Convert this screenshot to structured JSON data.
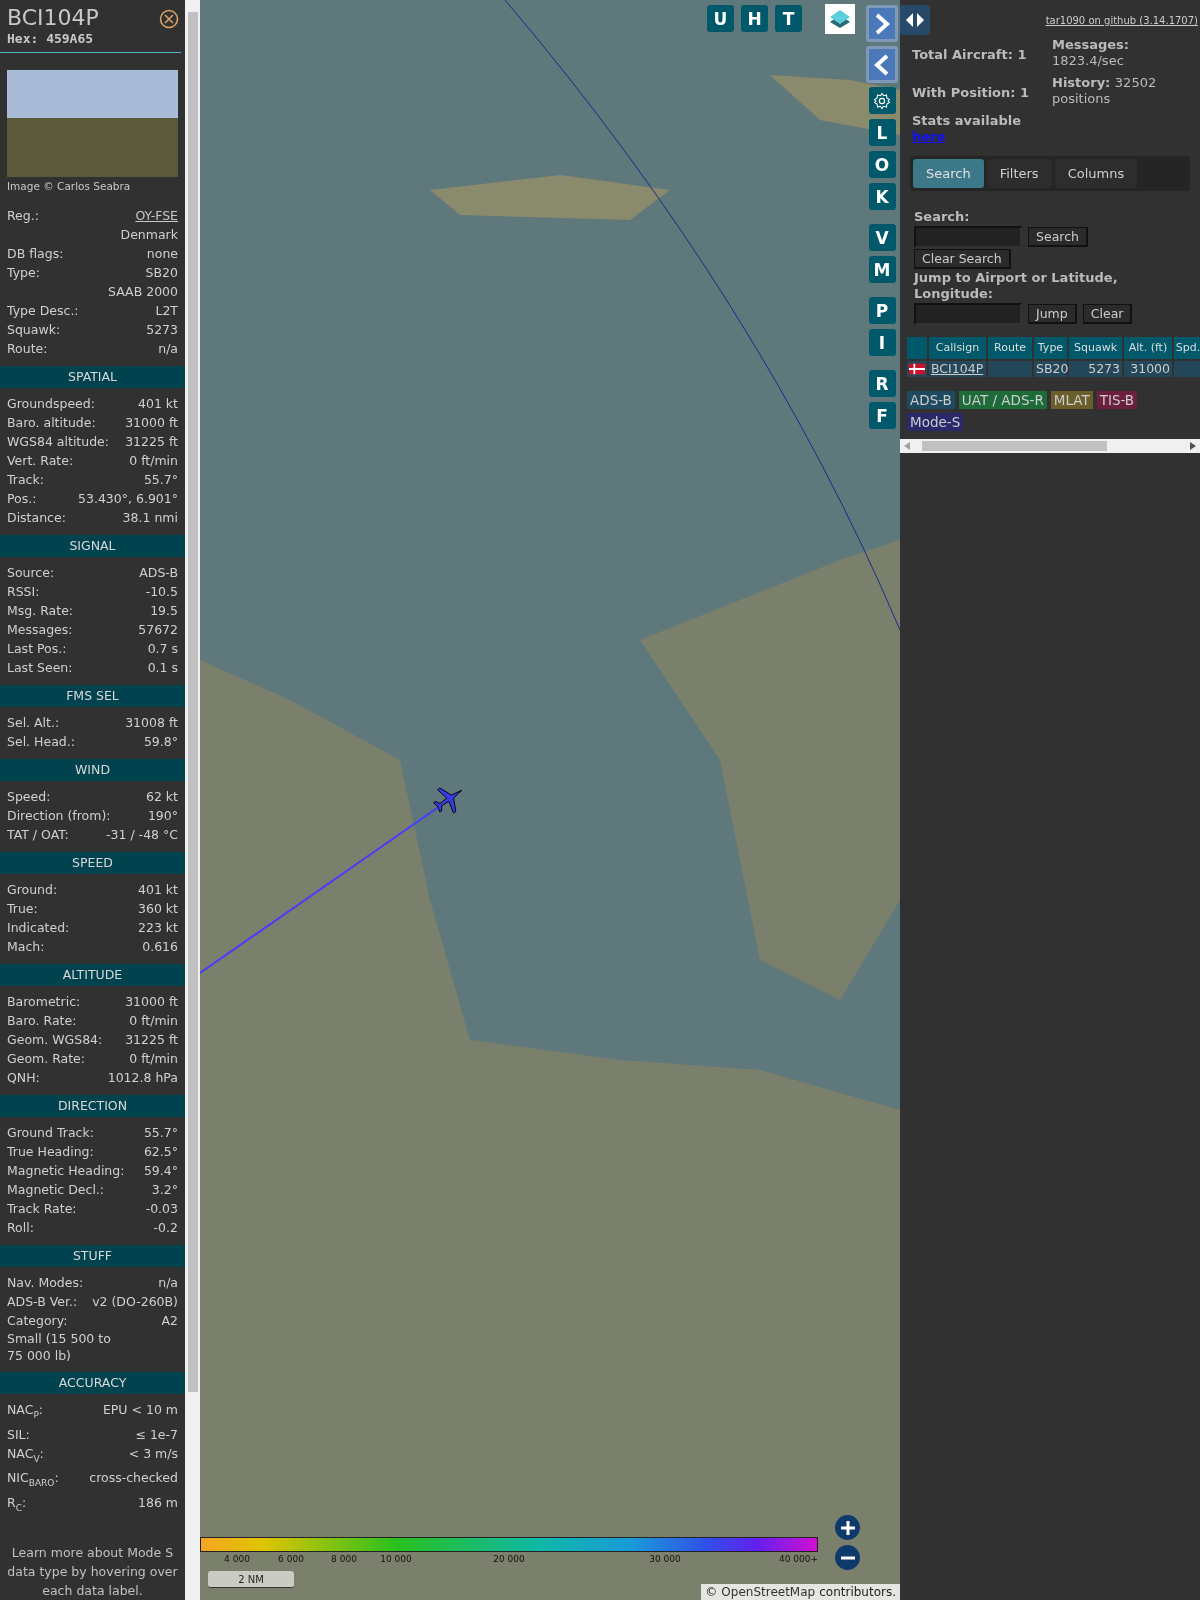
{
  "detail": {
    "callsign": "BCI104P",
    "hex_label": "Hex:",
    "hex": "459A65",
    "photo_credit": "Image © Carlos Seabra",
    "info_rows": [
      {
        "kind": "link",
        "label": "Reg.:",
        "value": "OY-FSE"
      },
      {
        "kind": "plain",
        "value": "Denmark"
      },
      {
        "kind": "plain",
        "label": "DB flags:",
        "value": "none"
      },
      {
        "kind": "plain",
        "label": "Type:",
        "value": "SB20"
      },
      {
        "kind": "plain",
        "value": "SAAB 2000"
      },
      {
        "kind": "plain",
        "label": "Type Desc.:",
        "value": "L2T"
      },
      {
        "kind": "plain",
        "label": "Squawk:",
        "value": "5273"
      },
      {
        "kind": "plain",
        "label": "Route:",
        "value": "n/a"
      }
    ],
    "sections": [
      {
        "title": "SPATIAL",
        "rows": [
          {
            "kind": "plain",
            "label": "Groundspeed:",
            "value": "401 kt"
          },
          {
            "kind": "plain",
            "label": "Baro. altitude:",
            "value": "31000 ft"
          },
          {
            "kind": "plain",
            "label": "WGS84 altitude:",
            "value": "31225 ft"
          },
          {
            "kind": "plain",
            "label": "Vert. Rate:",
            "value": "0 ft/min"
          },
          {
            "kind": "plain",
            "label": "Track:",
            "value": "55.7°"
          },
          {
            "kind": "plain",
            "label": "Pos.:",
            "value": "53.430°, 6.901°"
          },
          {
            "kind": "plain",
            "label": "Distance:",
            "value": "38.1 nmi"
          }
        ]
      },
      {
        "title": "SIGNAL",
        "rows": [
          {
            "kind": "plain",
            "label": "Source:",
            "value": "ADS-B"
          },
          {
            "kind": "plain",
            "label": "RSSI:",
            "value": "-10.5"
          },
          {
            "kind": "plain",
            "label": "Msg. Rate:",
            "value": "19.5"
          },
          {
            "kind": "plain",
            "label": "Messages:",
            "value": "57672"
          },
          {
            "kind": "plain",
            "label": "Last Pos.:",
            "value": "0.7 s"
          },
          {
            "kind": "plain",
            "label": "Last Seen:",
            "value": "0.1 s"
          }
        ]
      },
      {
        "title": "FMS SEL",
        "rows": [
          {
            "kind": "plain",
            "label": "Sel. Alt.:",
            "value": "31008 ft"
          },
          {
            "kind": "plain",
            "label": "Sel. Head.:",
            "value": "59.8°"
          }
        ]
      },
      {
        "title": "WIND",
        "rows": [
          {
            "kind": "plain",
            "label": "Speed:",
            "value": "62 kt"
          },
          {
            "kind": "plain",
            "label": "Direction (from):",
            "value": "190°"
          },
          {
            "kind": "plain",
            "label": "TAT / OAT:",
            "value": "-31 / -48 °C"
          }
        ]
      },
      {
        "title": "SPEED",
        "rows": [
          {
            "kind": "plain",
            "label": "Ground:",
            "value": "401 kt"
          },
          {
            "kind": "plain",
            "label": "True:",
            "value": "360 kt"
          },
          {
            "kind": "plain",
            "label": "Indicated:",
            "value": "223 kt"
          },
          {
            "kind": "plain",
            "label": "Mach:",
            "value": "0.616"
          }
        ]
      },
      {
        "title": "ALTITUDE",
        "rows": [
          {
            "kind": "plain",
            "label": "Barometric:",
            "value": "31000 ft"
          },
          {
            "kind": "plain",
            "label": "Baro. Rate:",
            "value": "0 ft/min"
          },
          {
            "kind": "plain",
            "label": "Geom. WGS84:",
            "value": "31225 ft"
          },
          {
            "kind": "plain",
            "label": "Geom. Rate:",
            "value": "0 ft/min"
          },
          {
            "kind": "plain",
            "label": "QNH:",
            "value": "1012.8 hPa"
          }
        ]
      },
      {
        "title": "DIRECTION",
        "rows": [
          {
            "kind": "plain",
            "label": "Ground Track:",
            "value": "55.7°"
          },
          {
            "kind": "plain",
            "label": "True Heading:",
            "value": "62.5°"
          },
          {
            "kind": "plain",
            "label": "Magnetic Heading:",
            "value": "59.4°"
          },
          {
            "kind": "plain",
            "label": "Magnetic Decl.:",
            "value": "3.2°"
          },
          {
            "kind": "plain",
            "label": "Track Rate:",
            "value": "-0.03"
          },
          {
            "kind": "plain",
            "label": "Roll:",
            "value": "-0.2"
          }
        ]
      },
      {
        "title": "STUFF",
        "rows": [
          {
            "kind": "plain",
            "label": "Nav. Modes:",
            "value": "n/a"
          },
          {
            "kind": "plain",
            "label": "ADS-B Ver.:",
            "value": "v2 (DO-260B)"
          },
          {
            "kind": "plain",
            "label": "Category:",
            "value": "A2"
          },
          {
            "kind": "wide",
            "value": "Small (15 500 to 75 000 lb)"
          }
        ]
      },
      {
        "title": "ACCURACY",
        "rows": [
          {
            "kind": "plain",
            "label": "NAC$_{P}$:",
            "value": "EPU < 10 m"
          },
          {
            "kind": "plain",
            "label": "SIL:",
            "value": "≤ 1e-7"
          },
          {
            "kind": "plain",
            "label": "NAC$_{V}$:",
            "value": "< 3 m/s"
          },
          {
            "kind": "plain",
            "label": "NIC$_{BARO}$:",
            "value": "cross-checked"
          },
          {
            "kind": "plain",
            "label": "R$_{C}$:",
            "value": "186 m"
          }
        ]
      }
    ],
    "footer_note": "Learn more about Mode S data type by hovering over each data label."
  },
  "map": {
    "top_buttons": [
      "U",
      "H",
      "T"
    ],
    "side_button_groups": [
      [
        "L",
        "O",
        "K"
      ],
      [
        "V",
        "M"
      ],
      [
        "P",
        "I"
      ],
      [
        "R",
        "F"
      ]
    ],
    "altitude_scale": [
      "4 000",
      "6 000",
      "8 000",
      "10 000",
      "20 000",
      "30 000",
      "40 000+"
    ],
    "scale_bar": "2 NM",
    "attribution": {
      "prefix": "©",
      "link": "OpenStreetMap",
      "suffix": "contributors."
    }
  },
  "sidebar": {
    "version_link": "tar1090 on github (3.14.1707)",
    "total_aircraft": "Total Aircraft: 1",
    "with_position": "With Position: 1",
    "messages_label": "Messages:",
    "messages_value": "1823.4/sec",
    "history_label": "History:",
    "history_value": "32502 positions",
    "stats_text": "Stats available",
    "stats_link": "here",
    "tabs": [
      {
        "label": "Search",
        "selected": true
      },
      {
        "label": "Filters",
        "selected": false
      },
      {
        "label": "Columns",
        "selected": false
      }
    ],
    "search_label": "Search:",
    "search_button": "Search",
    "clear_search_button": "Clear Search",
    "jump_label": "Jump to Airport or Latitude, Longitude:",
    "jump_button": "Jump",
    "clear_button": "Clear",
    "table": {
      "columns": [
        "Callsign",
        "Route",
        "Type",
        "Squawk",
        "Alt. (ft)",
        "Spd."
      ],
      "rows": [
        {
          "callsign": "BCI104P",
          "route": "",
          "type": "SB20",
          "squawk": "5273",
          "altitude": "31000"
        }
      ]
    },
    "legend": [
      {
        "label": "ADS-B",
        "color": "#1d4a5e"
      },
      {
        "label": "UAT / ADS-R",
        "color": "#1e6b3a"
      },
      {
        "label": "MLAT",
        "color": "#6b5e2a"
      },
      {
        "label": "TIS-B",
        "color": "#6b2040"
      },
      {
        "label": "Mode-S",
        "color": "#2a2a6b"
      }
    ]
  }
}
